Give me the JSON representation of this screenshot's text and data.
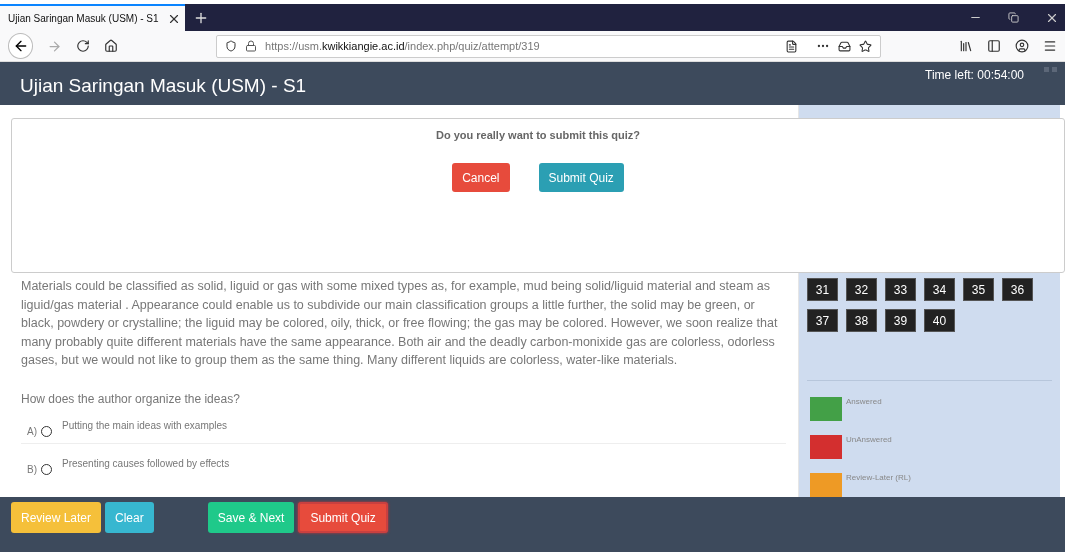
{
  "browser": {
    "tab": {
      "title": "Ujian Saringan Masuk (USM) - S1",
      "selected": true
    },
    "url": {
      "scheme": "https://usm.",
      "domain": "kwikkiangie.ac.id",
      "path": "/index.php/quiz/attempt/319"
    }
  },
  "header": {
    "title": "Ujian Saringan Masuk (USM) - S1",
    "timer": "Time left: 00:54:00"
  },
  "passage": "Materials could be classified as solid, liguid or gas with some mixed types as, for example, mud being solid/liguid material and steam as liguid/gas material . Appearance could enable us to subdivide our main classification groups a little further, the solid may be green, or black, powdery or crystalline; the liguid may be colored, oily, thick, or free flowing; the gas may be colored. However, we soon realize that many probably quite different materials have the same appearance. Both air and the deadly carbon-monixide gas are colorless, odorless gases, but we would not like to group them as the same thing. Many different liquids are colorless, water-like materials.",
  "question": "How does the author organize the ideas?",
  "options": [
    {
      "letter": "A)",
      "text": "Putting the main ideas with examples",
      "selected": false
    },
    {
      "letter": "B)",
      "text": "Presenting causes followed by effects",
      "selected": false
    }
  ],
  "sidebar": {
    "questions": [
      {
        "label": "31"
      },
      {
        "label": "32"
      },
      {
        "label": "33"
      },
      {
        "label": "34"
      },
      {
        "label": "35"
      },
      {
        "label": "36"
      },
      {
        "label": "37"
      },
      {
        "label": "38"
      },
      {
        "label": "39"
      },
      {
        "label": "40"
      }
    ],
    "legend": [
      {
        "label": "Answered",
        "color": "#43a047"
      },
      {
        "label": "UnAnswered",
        "color": "#d32f2f"
      },
      {
        "label": "Review-Later (RL)",
        "color": "#ee9a25"
      }
    ]
  },
  "footer": [
    {
      "label": "Review Later",
      "kind": "review"
    },
    {
      "label": "Clear",
      "kind": "clear"
    },
    {
      "label": "Save & Next",
      "kind": "save"
    },
    {
      "label": "Submit Quiz",
      "kind": "submit"
    }
  ],
  "modal": {
    "message": "Do you really want to submit this quiz?",
    "buttons": [
      {
        "label": "Cancel",
        "kind": "cancel"
      },
      {
        "label": "Submit Quiz",
        "kind": "confirm"
      }
    ]
  }
}
